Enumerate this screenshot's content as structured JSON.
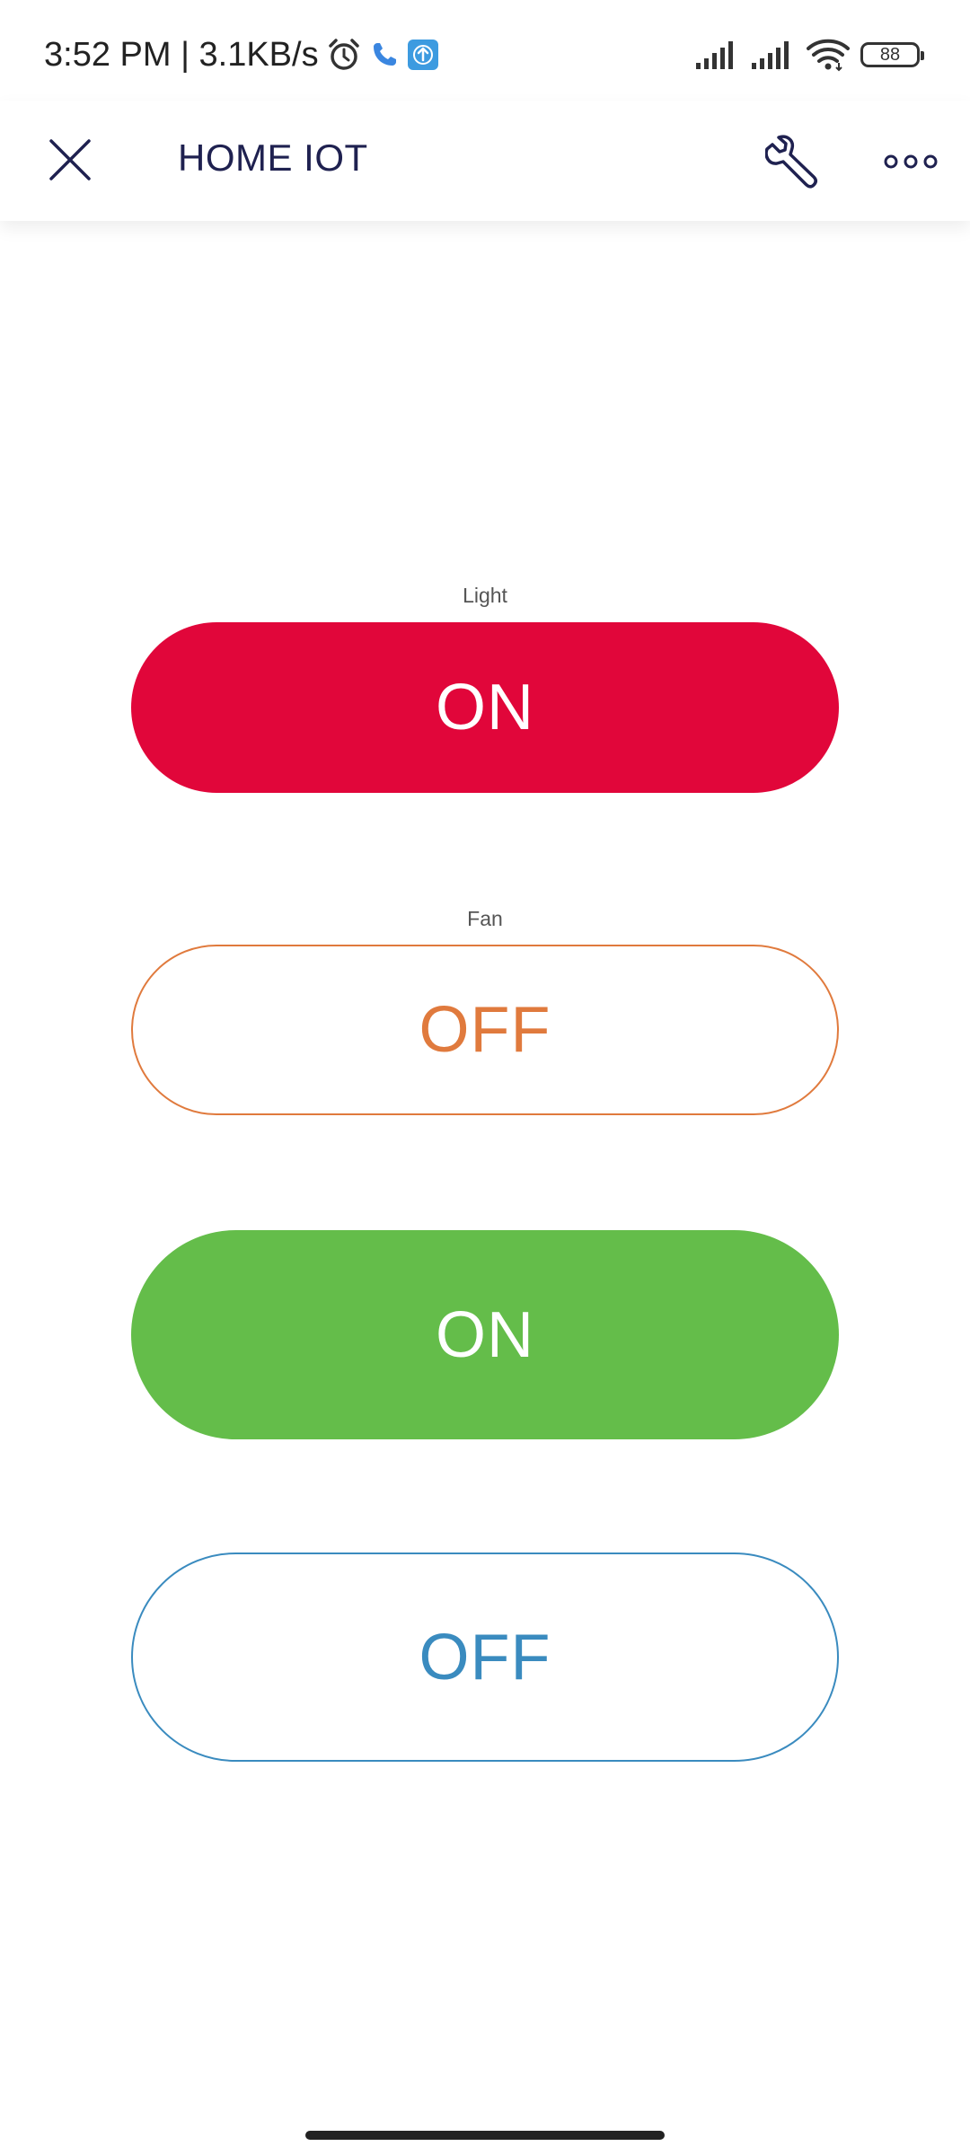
{
  "status_bar": {
    "time_speed": "3:52 PM | 3.1KB/s",
    "battery": "88",
    "icons": [
      "alarm-icon",
      "phone-icon",
      "upload-icon",
      "signal-icon",
      "signal-icon",
      "wifi-icon",
      "battery-icon"
    ]
  },
  "app_bar": {
    "title": "HOME IOT",
    "icons": [
      "close-icon",
      "wrench-icon",
      "more-icon"
    ]
  },
  "widgets": [
    {
      "label": "Light",
      "state": "ON",
      "color": "#e1063a",
      "style": "filled"
    },
    {
      "label": "Fan",
      "state": "OFF",
      "color": "#e07a3d",
      "style": "outlined"
    },
    {
      "label": "",
      "state": "ON",
      "color": "#64bd4a",
      "style": "filled"
    },
    {
      "label": "",
      "state": "OFF",
      "color": "#3a8bbf",
      "style": "outlined"
    }
  ]
}
